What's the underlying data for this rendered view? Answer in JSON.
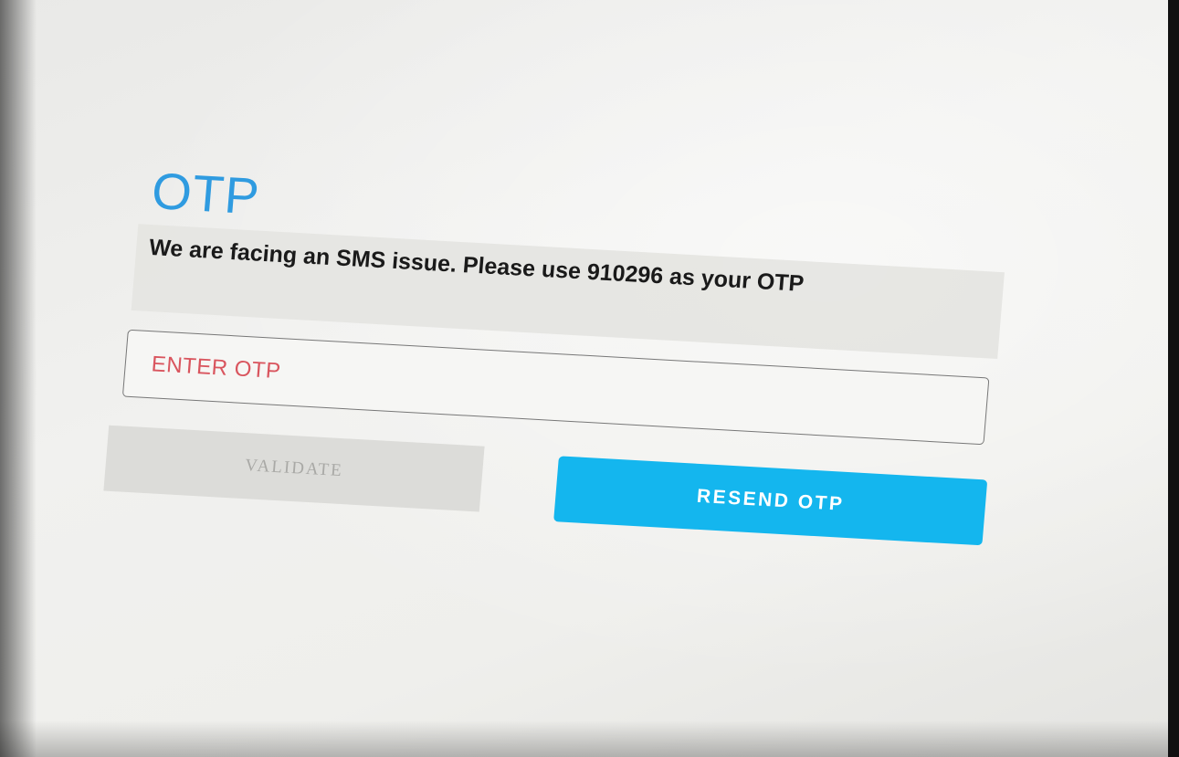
{
  "otp_form": {
    "title": "OTP",
    "message": "We are facing an SMS issue. Please use 910296 as your OTP",
    "input_value": "",
    "input_placeholder": "ENTER OTP",
    "validate_label": "VALIDATE",
    "resend_label": "RESEND OTP"
  },
  "colors": {
    "title": "#2f9be0",
    "placeholder": "#d9555e",
    "resend_button": "#14b6ee",
    "validate_button_disabled": "#dcdcd9"
  }
}
